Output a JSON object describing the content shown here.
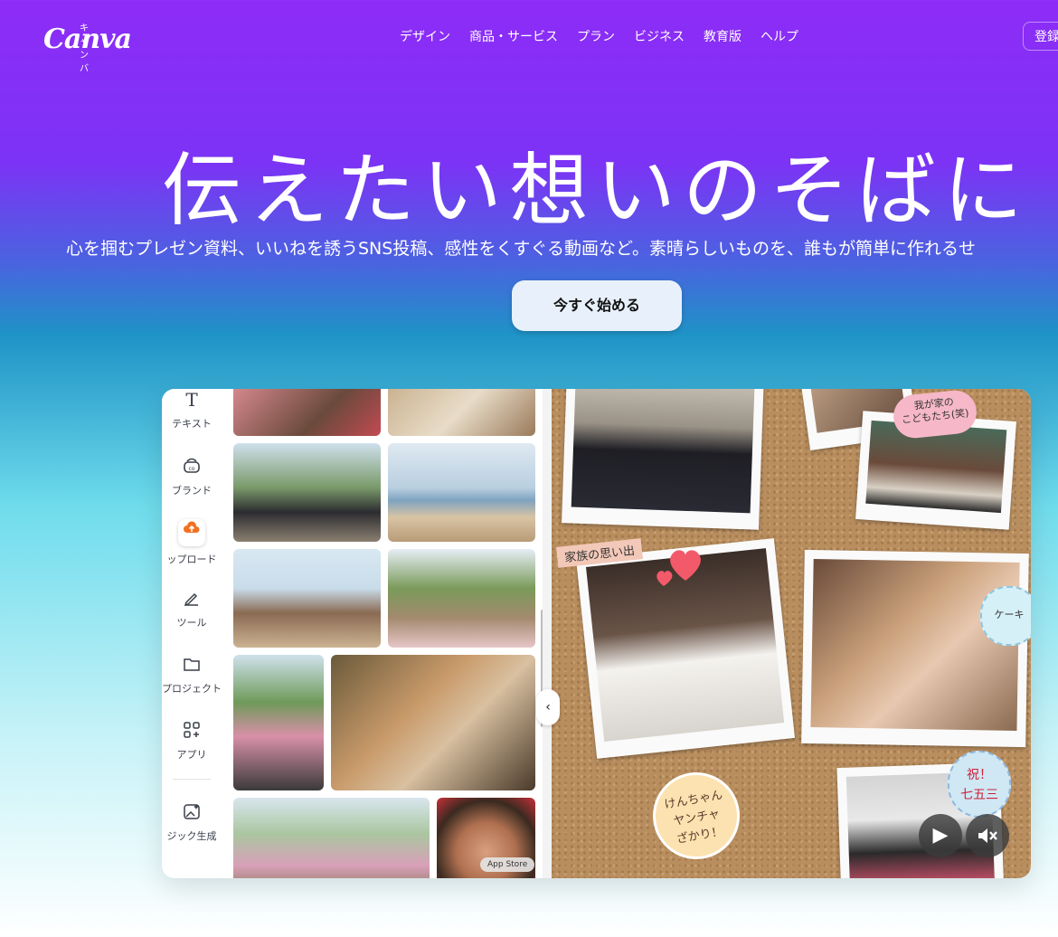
{
  "header": {
    "logo_kana": "キャンバ",
    "logo_word": "Canva",
    "nav": [
      "デザイン",
      "商品・サービス",
      "プラン",
      "ビジネス",
      "教育版",
      "ヘルプ"
    ],
    "register": "登録"
  },
  "hero": {
    "headline": "伝えたい想いのそばに",
    "subline": "心を掴むプレゼン資料、いいねを誘うSNS投稿、感性をくすぐる動画など。素晴らしいものを、誰もが簡単に作れるせ",
    "cta": "今すぐ始める"
  },
  "editor": {
    "sidebar": [
      {
        "label": "テキスト",
        "icon": "text-icon"
      },
      {
        "label": "ブランド",
        "icon": "brand-icon"
      },
      {
        "label": "ップロード",
        "icon": "upload-cloud-icon"
      },
      {
        "label": "ツール",
        "icon": "pen-tool-icon"
      },
      {
        "label": "プロジェクト",
        "icon": "folder-icon"
      },
      {
        "label": "アプリ",
        "icon": "apps-grid-icon"
      },
      {
        "label": "ジック生成",
        "icon": "magic-image-icon"
      }
    ],
    "collapse_glyph": "‹",
    "app_store": "App Store",
    "board_labels": {
      "memory": "家族の思い出",
      "kids": "我が家の\nこどもたち(笑)",
      "cake": "ケーキ",
      "celebration": "祝！\n七五三",
      "yancha": "けんちゃん\nヤンチャ\nざかり！"
    },
    "controls": {
      "play": "▶",
      "mute": "🔇"
    }
  },
  "colors": {
    "gradient_top": "#8d2cf6",
    "gradient_mid": "#1e93c6",
    "cta_bg": "#e8f1fb",
    "upload_accent": "#f37021"
  }
}
